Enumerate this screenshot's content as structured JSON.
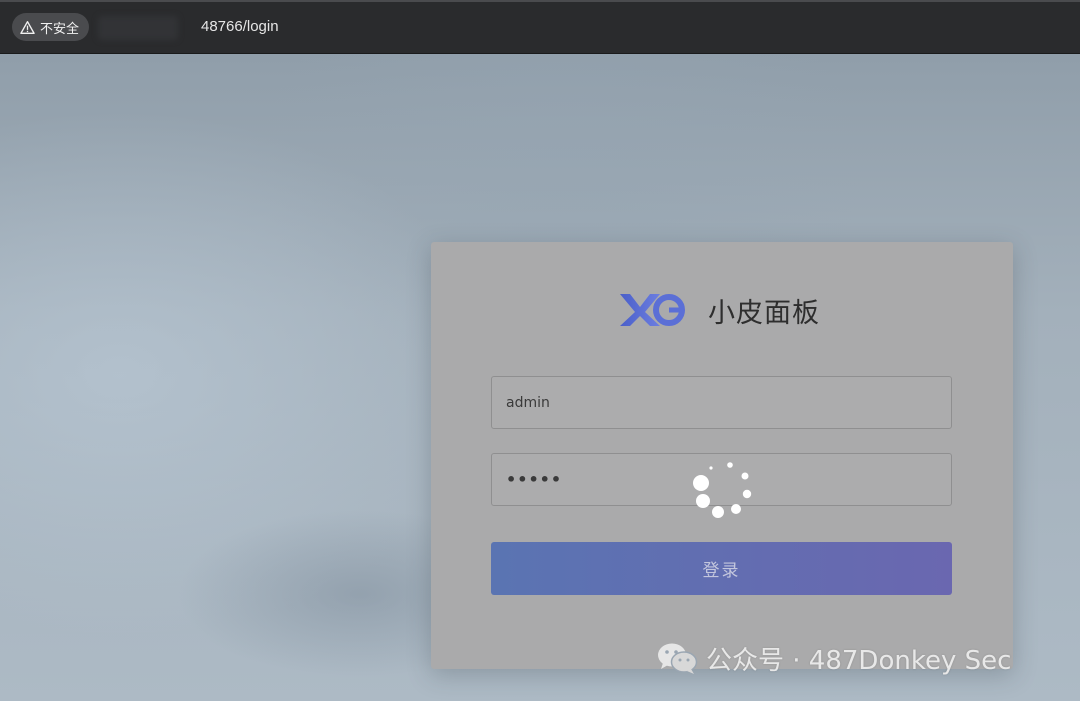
{
  "browser": {
    "security_label": "不安全",
    "url": "48766/login"
  },
  "login": {
    "brand_title": "小皮面板",
    "username_value": "admin",
    "password_value": "•••••",
    "submit_label": "登录"
  },
  "watermark": {
    "text": "公众号 · 487Donkey Sec"
  },
  "icons": {
    "security": "warning-triangle-icon",
    "brand": "xp-logo",
    "spinner": "loading-spinner-icon",
    "watermark": "wechat-icon"
  },
  "colors": {
    "brand_blue": "#5b6fd6",
    "button_gradient_start": "#5a74b2",
    "button_gradient_end": "#6a67b0"
  }
}
